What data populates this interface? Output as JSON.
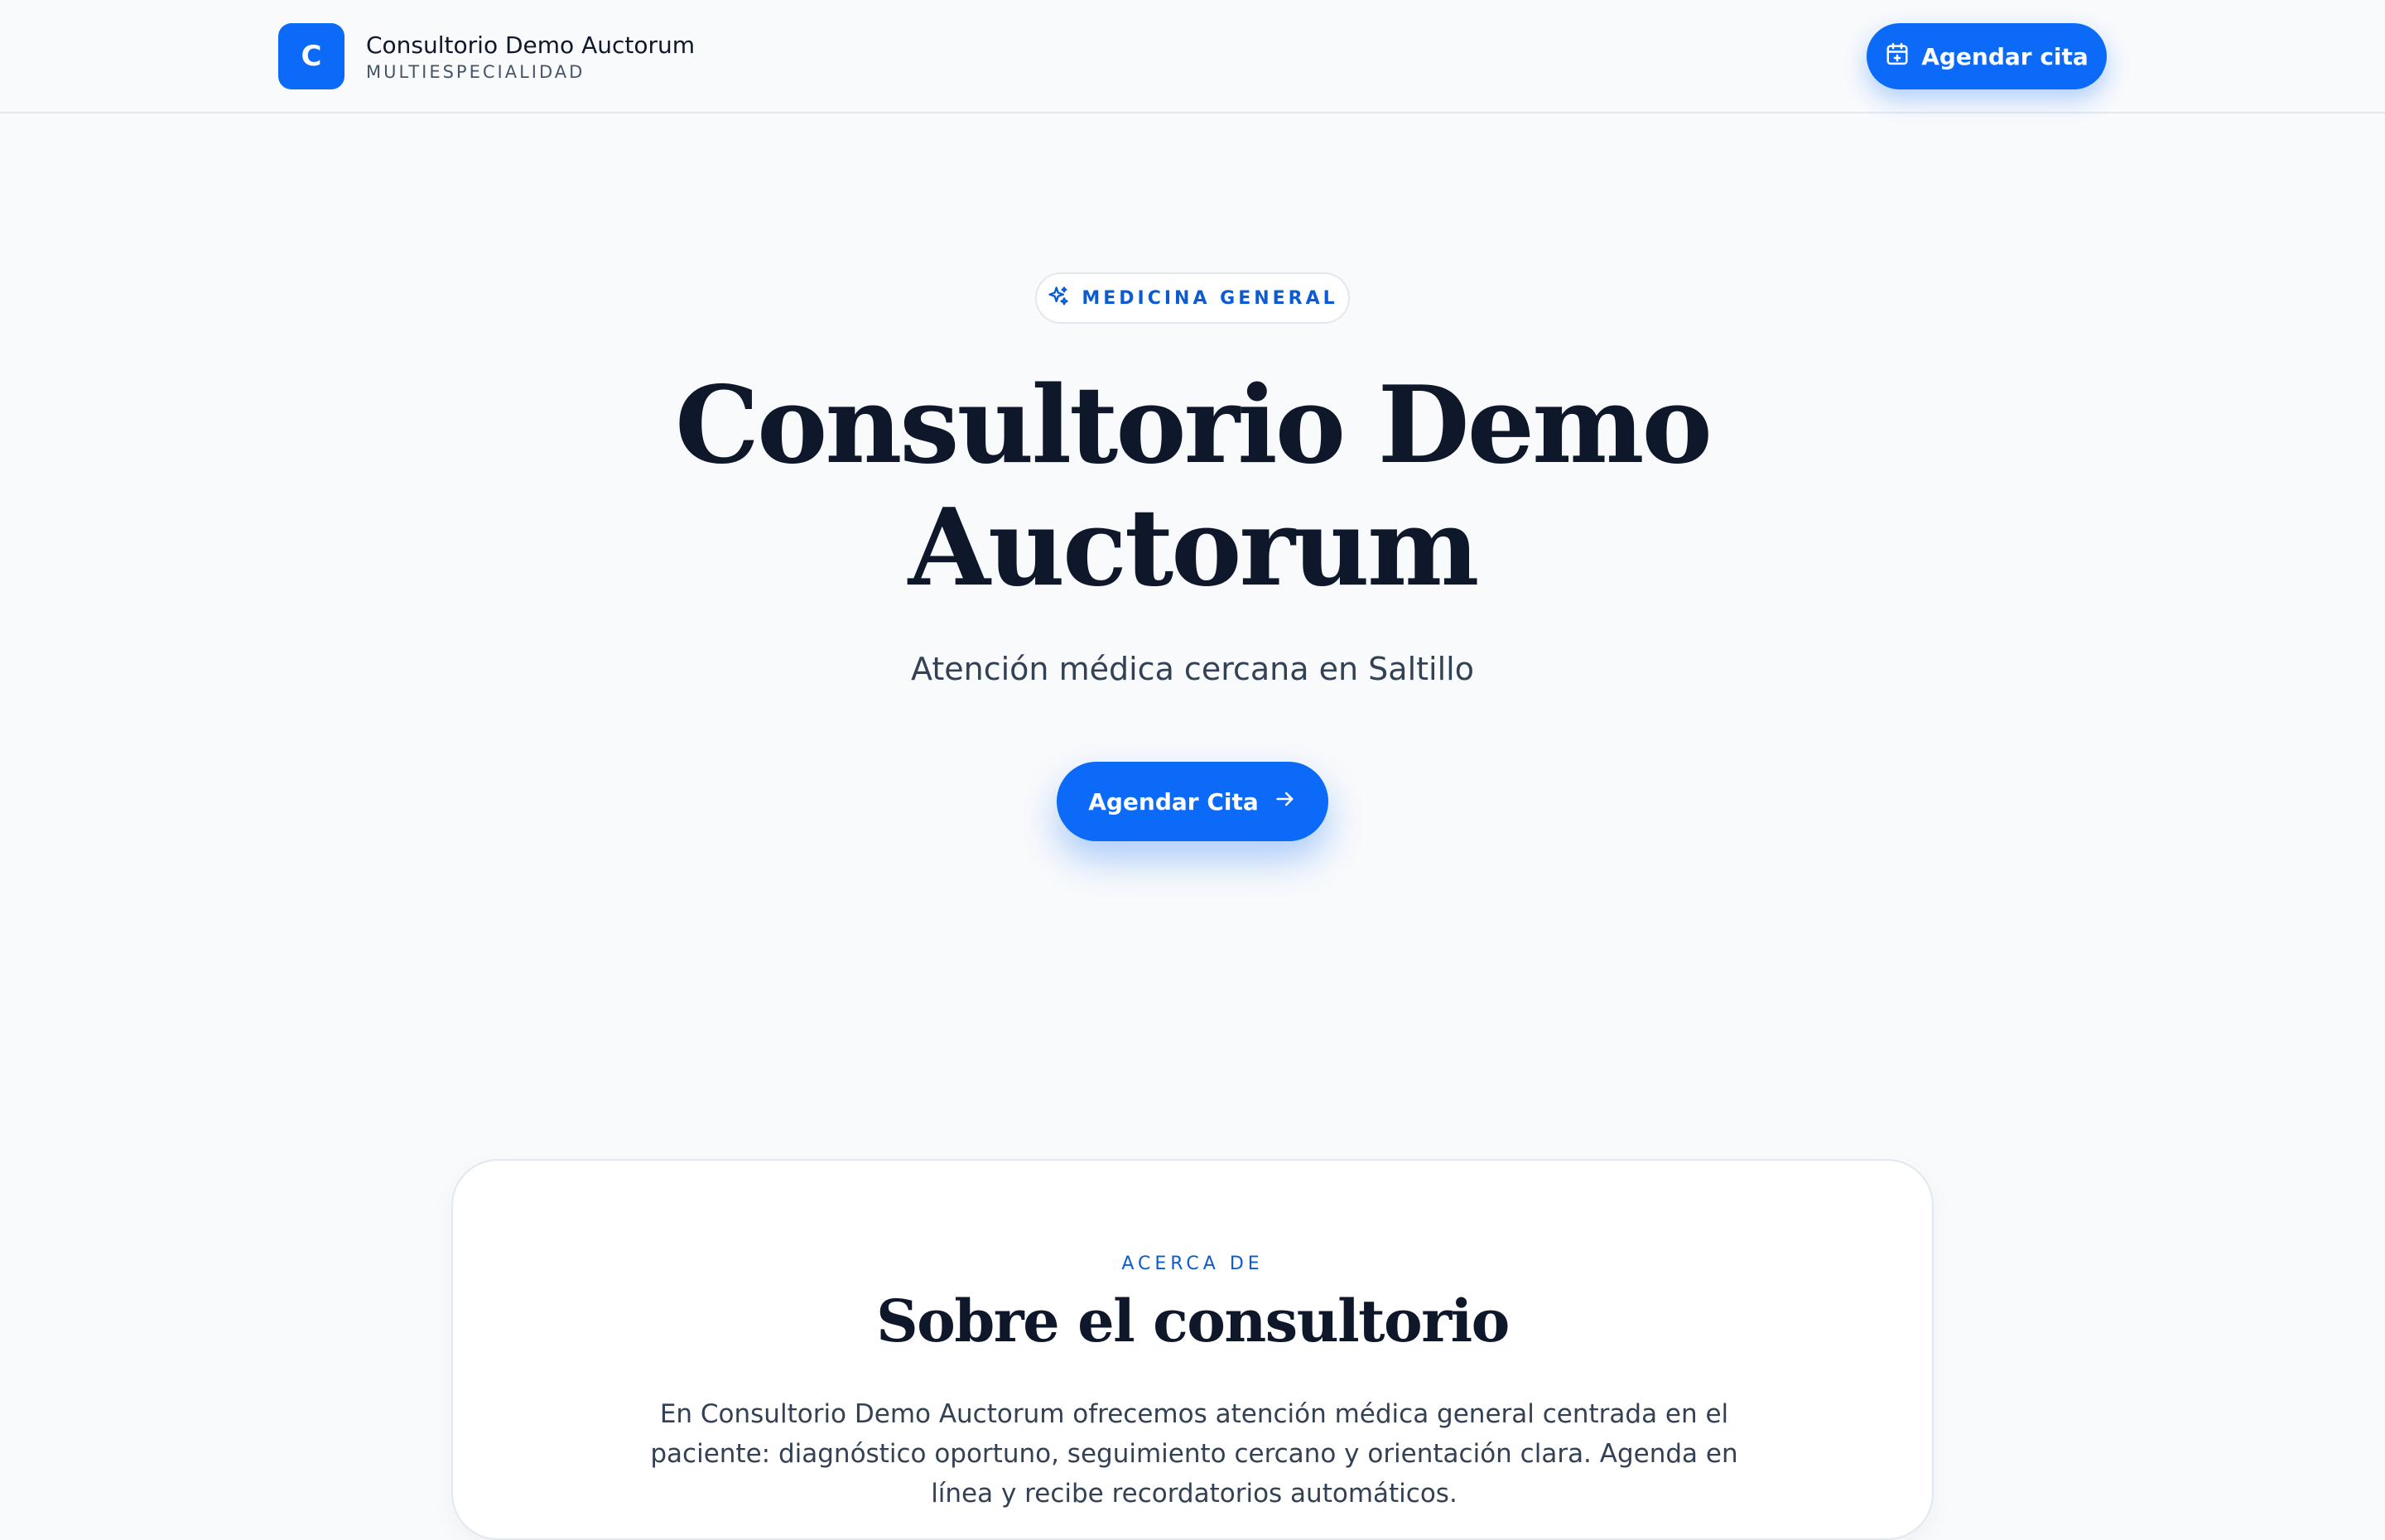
{
  "header": {
    "brand_initial": "C",
    "brand_name": "Consultorio Demo Auctorum",
    "brand_subtitle": "MULTIESPECIALIDAD",
    "cta_label": "Agendar cita",
    "cta_icon": "calendar-plus-icon"
  },
  "hero": {
    "chip_icon": "sparkles-icon",
    "chip_label": "MEDICINA GENERAL",
    "title_line1": "Consultorio Demo",
    "title_line2": "Auctorum",
    "subtitle": "Atención médica cercana en Saltillo",
    "cta_label": "Agendar Cita",
    "cta_icon": "arrow-right-icon"
  },
  "about": {
    "eyebrow": "ACERCA DE",
    "title": "Sobre el consultorio",
    "body": "En Consultorio Demo Auctorum ofrecemos atención médica general centrada en el paciente: diagnóstico oportuno, seguimiento cercano y orientación clara. Agenda en línea y recibe recordatorios automáticos."
  },
  "colors": {
    "accent": "#0b6af7",
    "accent_text": "#0b5bd3",
    "background": "#f8fafc",
    "heading": "#0f172a",
    "body_text": "#334155"
  }
}
